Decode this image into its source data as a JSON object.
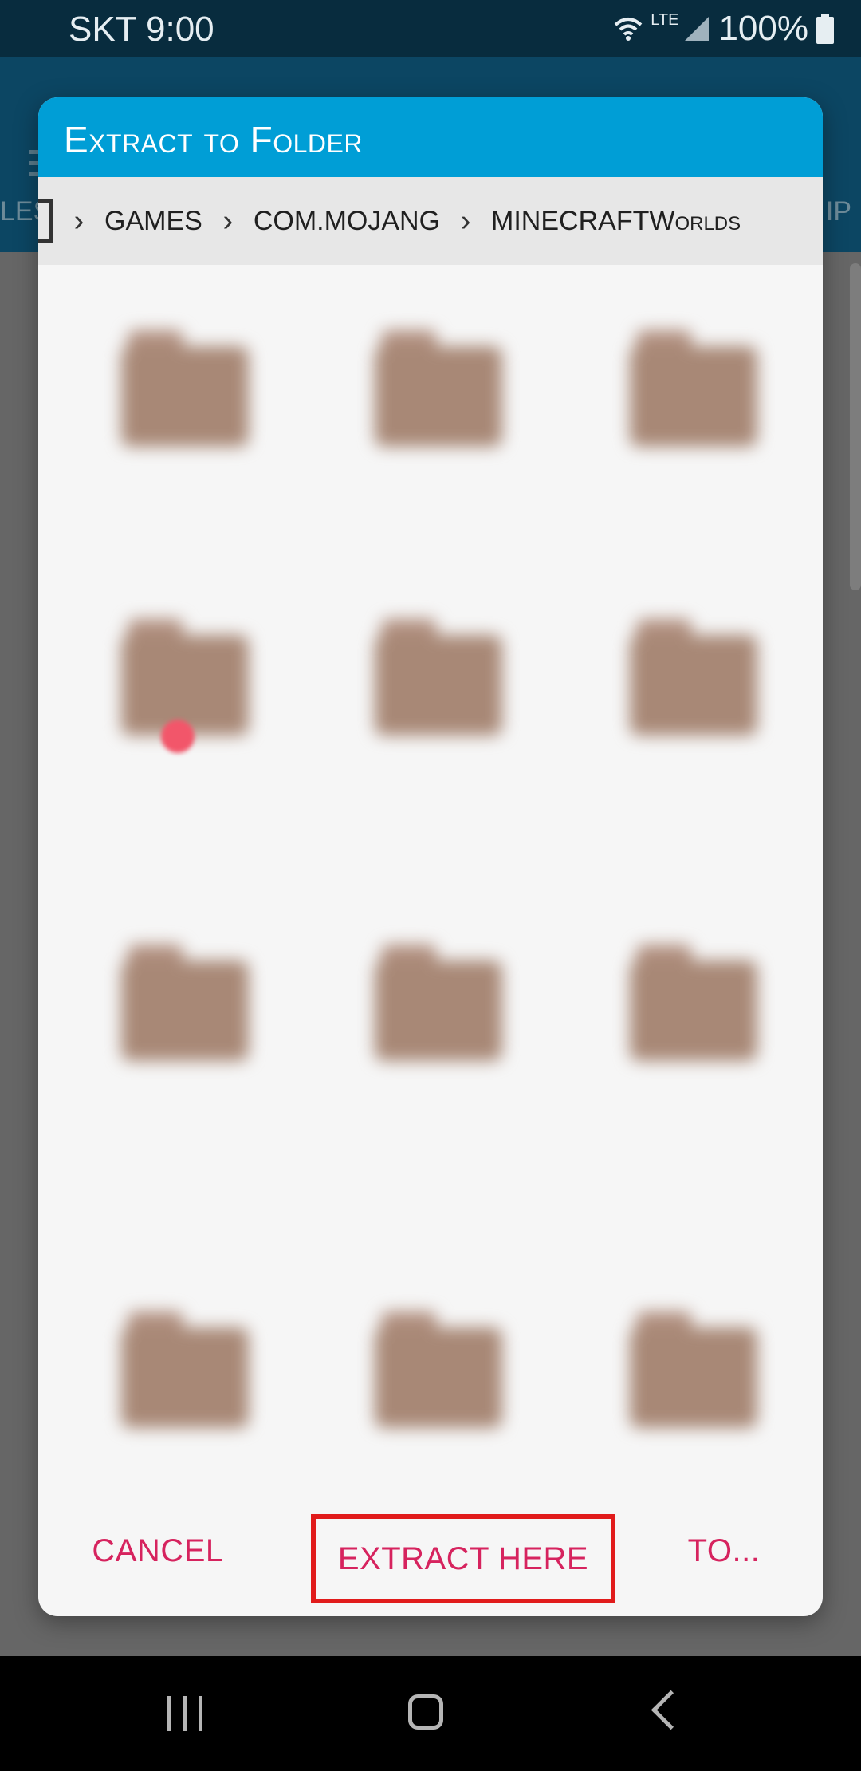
{
  "status_bar": {
    "carrier_time": "SKT 9:00",
    "network": "LTE",
    "battery": "100%"
  },
  "background_app": {
    "tab_left": "LES",
    "tab_right": "IP"
  },
  "dialog": {
    "title": "Extract to Folder",
    "breadcrumb": [
      "GAMES",
      "COM.MOJANG",
      "MINECRAFTWorlds"
    ],
    "folders": [
      {
        "name": "",
        "col": 0,
        "row": 0
      },
      {
        "name": "",
        "col": 1,
        "row": 0
      },
      {
        "name": "",
        "col": 2,
        "row": 0
      },
      {
        "name": "",
        "col": 0,
        "row": 1
      },
      {
        "name": "",
        "col": 1,
        "row": 1
      },
      {
        "name": "",
        "col": 2,
        "row": 1
      },
      {
        "name": "",
        "col": 0,
        "row": 2
      },
      {
        "name": "",
        "col": 1,
        "row": 2
      },
      {
        "name": "",
        "col": 2,
        "row": 2
      },
      {
        "name": "",
        "col": 0,
        "row": 3
      },
      {
        "name": "",
        "col": 1,
        "row": 3
      },
      {
        "name": "",
        "col": 2,
        "row": 3
      }
    ],
    "buttons": {
      "cancel": "CANCEL",
      "extract_here": "EXTRACT HERE",
      "to": "TO..."
    }
  },
  "colors": {
    "header": "#009ed6",
    "accent": "#d6235e",
    "highlight": "#e11b1b"
  }
}
